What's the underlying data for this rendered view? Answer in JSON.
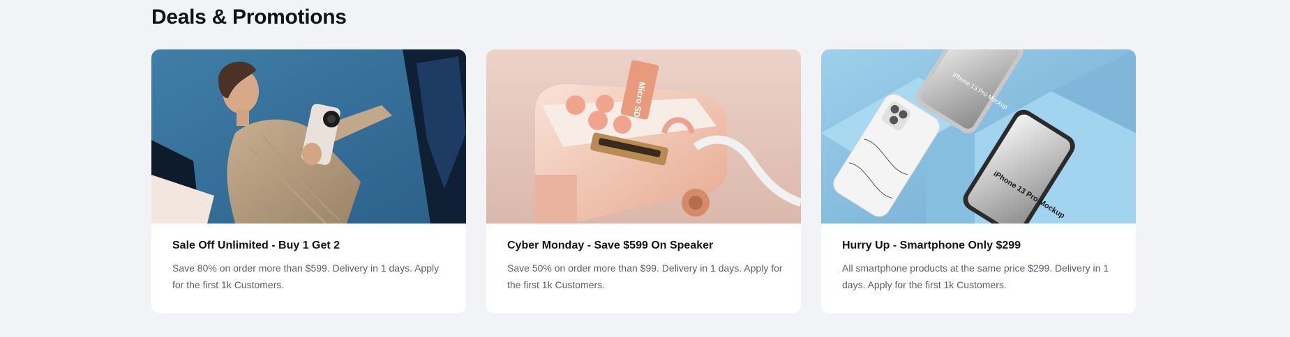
{
  "section": {
    "title": "Deals & Promotions"
  },
  "cards": [
    {
      "title": "Sale Off Unlimited - Buy 1 Get 2",
      "description": "Save 80% on order more than $599. Delivery in 1 days. Apply for the first 1k Customers.",
      "image_name": "woman-holding-phone-image"
    },
    {
      "title": "Cyber Monday - Save $599 On Speaker",
      "description": "Save 50% on order more than $99. Delivery in 1 days. Apply for the first 1k Customers.",
      "image_name": "pink-speaker-image",
      "image_text": "Micro SD"
    },
    {
      "title": "Hurry Up - Smartphone Only $299",
      "description": "All smartphone products at the same price $299. Delivery in 1 days. Apply for the first 1k Customers.",
      "image_name": "iphone-mockups-image",
      "image_text_a": "iPhone 13 Pro Mockup",
      "image_text_b": "iPhone 13 Pro Mockup"
    }
  ],
  "colors": {
    "page_background": "#f2f3f7",
    "card_background": "#ffffff",
    "title_text": "#141414",
    "description_text": "#5b5e66"
  }
}
